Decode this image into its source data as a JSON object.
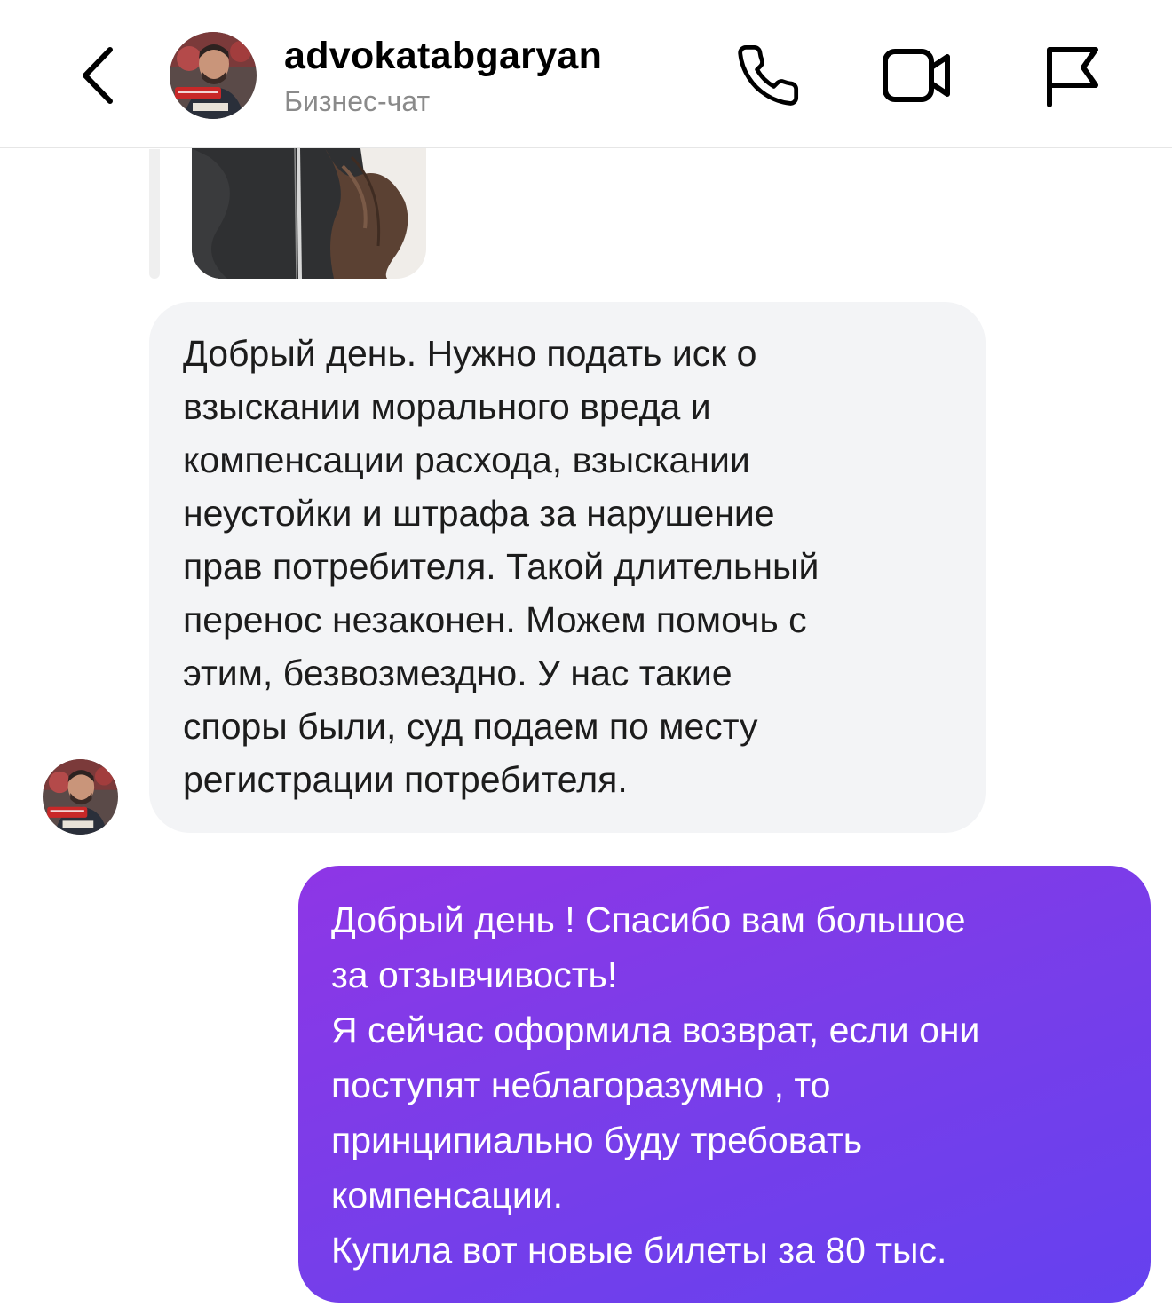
{
  "header": {
    "username": "advokatabgaryan",
    "subtitle": "Бизнес-чат",
    "icons": {
      "back": "chevron-left-icon",
      "call": "phone-icon",
      "video": "video-camera-icon",
      "report": "flag-icon"
    }
  },
  "messages": [
    {
      "direction": "incoming",
      "type": "photo",
      "description": ""
    },
    {
      "direction": "incoming",
      "type": "text",
      "text": "Добрый день. Нужно подать иск о\nвзыскании морального вреда и\nкомпенсации расхода, взыскании\nнеустойки и штрафа за нарушение\nправ потребителя. Такой длительный\nперенос незаконен. Можем помочь с\nэтим, безвозмездно. У нас такие\nспоры были, суд подаем по месту\nрегистрации потребителя."
    },
    {
      "direction": "outgoing",
      "type": "text",
      "text": "Добрый день ! Спасибо вам большое\nза отзывчивость!\nЯ сейчас оформила возврат, если они\nпоступят неблагоразумно , то\nпринципиально буду требовать\nкомпенсации.\nКупила вот новые билеты за 80 тыс."
    }
  ],
  "colors": {
    "incoming_bubble": "#f3f4f6",
    "outgoing_bubble_start": "#8e36e6",
    "outgoing_bubble_end": "#6541ef",
    "subtitle": "#8a8a8a"
  }
}
